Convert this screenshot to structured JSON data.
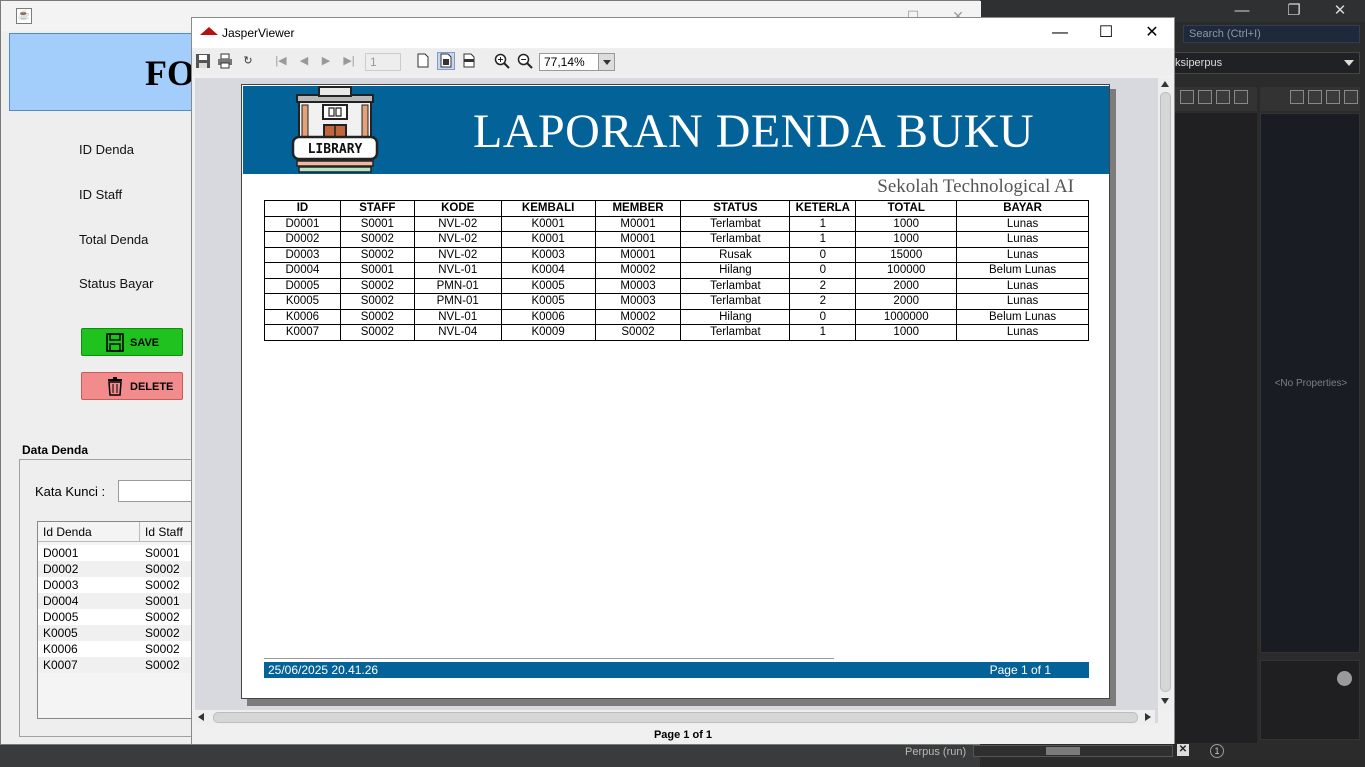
{
  "ide": {
    "search_placeholder": "Search (Ctrl+I)",
    "combo_value": "ksiperpus",
    "no_properties": "<No Properties>",
    "run_status": "Perpus (run)",
    "notification_count": "1"
  },
  "form": {
    "header_title": "FO",
    "labels": {
      "id_denda": "ID Denda",
      "id_staff": "ID Staff",
      "total_denda": "Total Denda",
      "status_bayar": "Status Bayar"
    },
    "save_label": "SAVE",
    "delete_label": "DELETE",
    "data_title": "Data Denda",
    "kata_kunci_label": "Kata Kunci :",
    "kata_kunci_value": "",
    "table": {
      "columns": [
        "Id Denda",
        "Id Staff"
      ],
      "rows": [
        [
          "D0001",
          "S0001"
        ],
        [
          "D0002",
          "S0002"
        ],
        [
          "D0003",
          "S0002"
        ],
        [
          "D0004",
          "S0001"
        ],
        [
          "D0005",
          "S0002"
        ],
        [
          "K0005",
          "S0002"
        ],
        [
          "K0006",
          "S0002"
        ],
        [
          "K0007",
          "S0002"
        ]
      ]
    }
  },
  "viewer": {
    "title": "JasperViewer",
    "page_number": "1",
    "zoom": "77,14%",
    "status": "Page 1 of 1"
  },
  "report": {
    "title": "LAPORAN DENDA BUKU",
    "logo_text": "LIBRARY",
    "school": "Sekolah Technological AI",
    "columns": [
      "ID",
      "STAFF",
      "KODE",
      "KEMBALI",
      "MEMBER",
      "STATUS",
      "KETERLA",
      "TOTAL",
      "BAYAR"
    ],
    "rows": [
      [
        "D0001",
        "S0001",
        "NVL-02",
        "K0001",
        "M0001",
        "Terlambat",
        "1",
        "1000",
        "Lunas"
      ],
      [
        "D0002",
        "S0002",
        "NVL-02",
        "K0001",
        "M0001",
        "Terlambat",
        "1",
        "1000",
        "Lunas"
      ],
      [
        "D0003",
        "S0002",
        "NVL-02",
        "K0003",
        "M0001",
        "Rusak",
        "0",
        "15000",
        "Lunas"
      ],
      [
        "D0004",
        "S0001",
        "NVL-01",
        "K0004",
        "M0002",
        "Hilang",
        "0",
        "100000",
        "Belum Lunas"
      ],
      [
        "D0005",
        "S0002",
        "PMN-01",
        "K0005",
        "M0003",
        "Terlambat",
        "2",
        "2000",
        "Lunas"
      ],
      [
        "K0005",
        "S0002",
        "PMN-01",
        "K0005",
        "M0003",
        "Terlambat",
        "2",
        "2000",
        "Lunas"
      ],
      [
        "K0006",
        "S0002",
        "NVL-01",
        "K0006",
        "M0002",
        "Hilang",
        "0",
        "1000000",
        "Belum Lunas"
      ],
      [
        "K0007",
        "S0002",
        "NVL-04",
        "K0009",
        "S0002",
        "Terlambat",
        "1",
        "1000",
        "Lunas"
      ]
    ],
    "footer_date": "25/06/2025 20.41.26",
    "footer_page": "Page 1 of 1"
  }
}
